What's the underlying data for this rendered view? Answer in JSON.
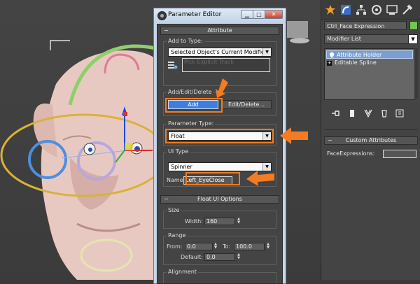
{
  "viewport": {
    "toon_skin": "#e8c9c2",
    "orange_ring": "#d8b23a",
    "blue_ring": "#4c8fe0",
    "lilac_ring": "#b8a6e0",
    "green_arc": "#8ecf6a",
    "pink_arc": "#e07a9a"
  },
  "parameter_editor": {
    "title": "Parameter Editor",
    "window_buttons": [
      "min-icon",
      "max-icon",
      "close-icon"
    ],
    "attribute_rollout": "Attribute",
    "add_to_type_label": "Add to Type:",
    "add_to_type_value": "Selected Object's Current Modifier",
    "pick_explicit_track": "Pick Explicit Track",
    "add_edit_delete_label": "Add/Edit/Delete",
    "add_button": "Add",
    "edit_delete_button": "Edit/Delete...",
    "parameter_type_label": "Parameter Type:",
    "parameter_type_value": "Float",
    "ui_type_label": "UI Type",
    "ui_type_value": "Spinner",
    "name_label": "Name:",
    "name_value": "Left_EyeClose",
    "float_ui_rollout": "Float UI Options",
    "size_label": "Size",
    "width_label": "Width:",
    "width_value": "160",
    "range_label": "Range",
    "from_label": "From:",
    "from_value": "0.0",
    "to_label": "To:",
    "to_value": "100.0",
    "default_label": "Default:",
    "default_value": "0.0",
    "alignment_label": "Alignment",
    "accent_color": "#f47c20",
    "add_button_color": "#3e7ee0"
  },
  "command_panel": {
    "tabs": [
      "star-icon",
      "bend-arrow-icon",
      "hierarchy-icon",
      "motion-icon",
      "display-icon",
      "hammer-icon"
    ],
    "object_name": "Ctrl_Face Expression",
    "object_color": "#6ec84a",
    "modifier_list": "Modifier List",
    "stack": [
      {
        "label": "Attribute Holder",
        "selected": true
      },
      {
        "label": "Editable Spline",
        "selected": false
      }
    ],
    "stack_tools": [
      "pin-icon",
      "show-end-icon",
      "make-unique-icon",
      "remove-modifier-icon",
      "configure-icon"
    ],
    "custom_attributes_rollout": "Custom Attributes",
    "face_expressions_label": "FaceExpressions:"
  }
}
